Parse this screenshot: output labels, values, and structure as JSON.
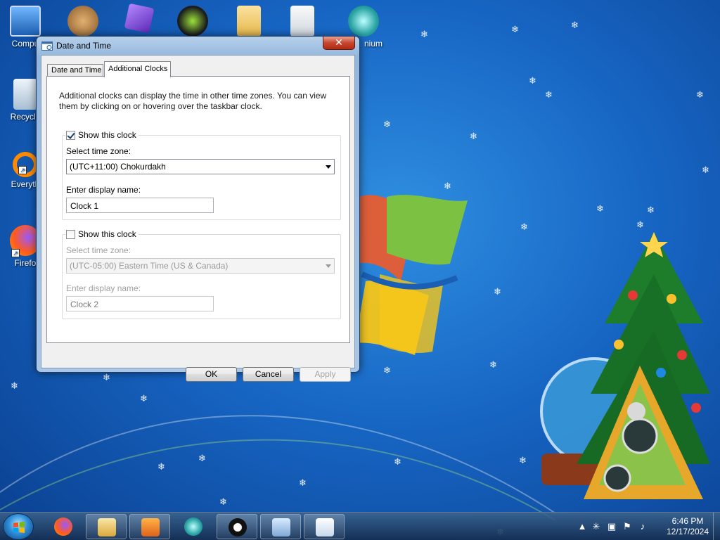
{
  "desktop": {
    "icons": [
      {
        "label": "Compu",
        "name": "computer"
      },
      {
        "label": "Recycle",
        "name": "recycle-bin"
      },
      {
        "label": "Everyth",
        "name": "everything"
      },
      {
        "label": "Firefo",
        "name": "firefox"
      },
      {
        "label": "nium",
        "name": "chromium"
      }
    ]
  },
  "dialog": {
    "title": "Date and Time",
    "close_label": "✕",
    "tabs": [
      "Date and Time",
      "Additional Clocks"
    ],
    "active_tab": "Additional Clocks",
    "intro": "Additional clocks can display the time in other time zones. You can view them by clicking on or hovering over the taskbar clock.",
    "clock1": {
      "show_label": "Show this clock",
      "checked": true,
      "timezone_label": "Select time zone:",
      "timezone_value": "(UTC+11:00) Chokurdakh",
      "name_label": "Enter display name:",
      "name_value": "Clock 1"
    },
    "clock2": {
      "show_label": "Show this clock",
      "checked": false,
      "timezone_label": "Select time zone:",
      "timezone_value": "(UTC-05:00) Eastern Time (US & Canada)",
      "name_label": "Enter display name:",
      "name_value": "Clock 2"
    },
    "buttons": {
      "ok": "OK",
      "cancel": "Cancel",
      "apply": "Apply"
    }
  },
  "taskbar": {
    "clock_time": "6:46 PM",
    "clock_date": "12/17/2024",
    "pinned": [
      "firefox",
      "file-explorer",
      "media-player",
      "chromium",
      "ble-tool",
      "network-tool",
      "date-time"
    ],
    "tray": [
      "show-hidden-icons",
      "snowflake",
      "network",
      "action-center-flag",
      "volume"
    ]
  },
  "colors": {
    "accent": "#1766c4",
    "titlebar": "#a9c6e6"
  }
}
